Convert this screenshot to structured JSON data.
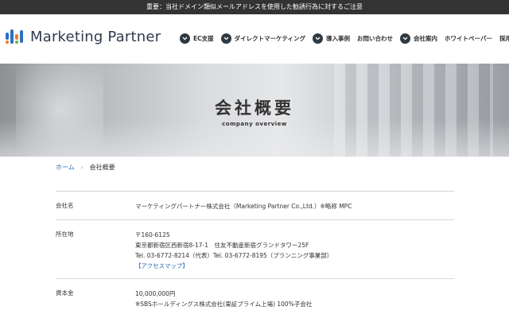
{
  "notice": "重要：当社ドメイン類似メールアドレスを使用した勧誘行為に対するご注意",
  "brand": {
    "name": "Marketing Partner"
  },
  "nav": {
    "items": [
      {
        "label": "EC支援",
        "has_chevron": true
      },
      {
        "label": "ダイレクトマーケティング",
        "has_chevron": true
      },
      {
        "label": "導入事例",
        "has_chevron": true
      },
      {
        "label": "お問い合わせ",
        "has_chevron": false
      },
      {
        "label": "会社案内",
        "has_chevron": true
      },
      {
        "label": "ホワイトペーパー",
        "has_chevron": false
      },
      {
        "label": "採用",
        "has_chevron": false
      }
    ]
  },
  "hero": {
    "title": "会社概要",
    "subtitle": "company overview"
  },
  "breadcrumb": {
    "home": "ホーム",
    "separator": "›",
    "current": "会社概要"
  },
  "company": {
    "rows": [
      {
        "label": "会社名",
        "lines": [
          "マーケティングパートナー株式会社（Marketing Partner Co.,Ltd.）※略称 MPC"
        ]
      },
      {
        "label": "所在地",
        "lines": [
          "〒160-6125",
          "東京都新宿区西新宿8-17-1　住友不動産新宿グランドタワー25F",
          "Tel. 03-6772-8214（代表）Tel. 03-6772-8195（プランニング事業部）"
        ],
        "link": "【アクセスマップ】"
      },
      {
        "label": "資本金",
        "lines": [
          "10,000,000円",
          "※SBSホールディングス株式会社(東証プライム上場) 100%子会社"
        ]
      }
    ]
  },
  "colors": {
    "topbar": "#333333",
    "link": "#2a6fb5",
    "nav_chevron_bg": "#2f3942",
    "logo_blue": "#2f6fc0",
    "logo_orange": "#f07a2a",
    "logo_green": "#6ab23f"
  }
}
